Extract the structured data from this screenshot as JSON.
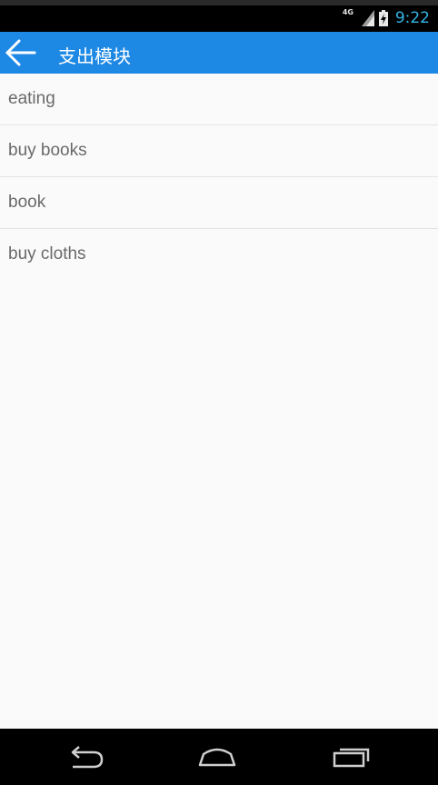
{
  "status_bar": {
    "network": "4G",
    "time": "9:22",
    "icons": [
      "signal-icon",
      "battery-charging-icon"
    ]
  },
  "app_bar": {
    "title": "支出模块",
    "back_icon": "arrow-back-icon"
  },
  "list": {
    "items": [
      {
        "label": "eating"
      },
      {
        "label": "buy books"
      },
      {
        "label": "book"
      },
      {
        "label": "buy cloths"
      }
    ]
  },
  "nav_bar": {
    "icons": [
      "nav-back-icon",
      "nav-home-icon",
      "nav-recents-icon"
    ]
  },
  "colors": {
    "app_bar": "#1e88e5",
    "clock": "#33b5e5",
    "background": "#fafafa",
    "list_text": "#6a6a6a"
  }
}
